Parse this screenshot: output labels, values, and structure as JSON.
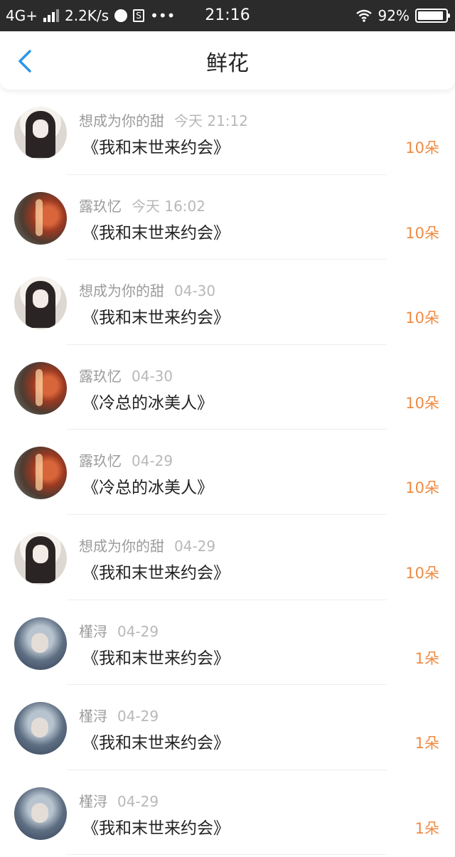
{
  "status_bar": {
    "network": "4G+",
    "speed": "2.2K/s",
    "extra": "•••",
    "time": "21:16",
    "battery_percent": "92%",
    "battery_level": 0.92
  },
  "header": {
    "title": "鲜花",
    "back_icon": "chevron-left-icon",
    "accent_color": "#2f97e6"
  },
  "colors": {
    "quantity": "#f08a40"
  },
  "rows": [
    {
      "user": "想成为你的甜",
      "time": "今天 21:12",
      "book": "《我和末世来约会》",
      "qty": "10朵",
      "avatar": "avatar-girl-dark-hair"
    },
    {
      "user": "露玖忆",
      "time": "今天 16:02",
      "book": "《我和末世来约会》",
      "qty": "10朵",
      "avatar": "avatar-red-flowers"
    },
    {
      "user": "想成为你的甜",
      "time": "04-30",
      "book": "《我和末世来约会》",
      "qty": "10朵",
      "avatar": "avatar-girl-dark-hair"
    },
    {
      "user": "露玖忆",
      "time": "04-30",
      "book": "《冷总的冰美人》",
      "qty": "10朵",
      "avatar": "avatar-red-flowers"
    },
    {
      "user": "露玖忆",
      "time": "04-29",
      "book": "《冷总的冰美人》",
      "qty": "10朵",
      "avatar": "avatar-red-flowers"
    },
    {
      "user": "想成为你的甜",
      "time": "04-29",
      "book": "《我和末世来约会》",
      "qty": "10朵",
      "avatar": "avatar-girl-dark-hair"
    },
    {
      "user": "槿浔",
      "time": "04-29",
      "book": "《我和末世来约会》",
      "qty": "1朵",
      "avatar": "avatar-girl-blue-background"
    },
    {
      "user": "槿浔",
      "time": "04-29",
      "book": "《我和末世来约会》",
      "qty": "1朵",
      "avatar": "avatar-girl-blue-background"
    },
    {
      "user": "槿浔",
      "time": "04-29",
      "book": "《我和末世来约会》",
      "qty": "1朵",
      "avatar": "avatar-girl-blue-background"
    }
  ]
}
